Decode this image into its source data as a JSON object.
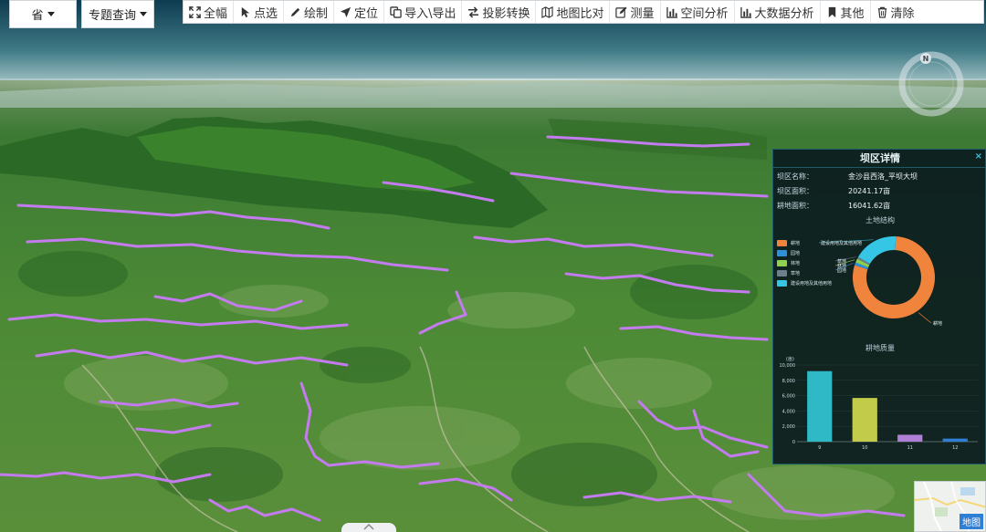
{
  "selects": {
    "province": "省",
    "topic_query": "专题查询"
  },
  "toolbar": {
    "items": [
      {
        "label": "全幅",
        "icon": "fullscreen-icon"
      },
      {
        "label": "点选",
        "icon": "pointer-icon"
      },
      {
        "label": "绘制",
        "icon": "pencil-icon"
      },
      {
        "label": "定位",
        "icon": "location-arrow-icon"
      },
      {
        "label": "导入\\导出",
        "icon": "copy-icon"
      },
      {
        "label": "投影转换",
        "icon": "exchange-icon"
      },
      {
        "label": "地图比对",
        "icon": "map-icon"
      },
      {
        "label": "测量",
        "icon": "edit-icon"
      },
      {
        "label": "空间分析",
        "icon": "bar-chart-icon"
      },
      {
        "label": "大数据分析",
        "icon": "bar-chart-icon"
      },
      {
        "label": "其他",
        "icon": "bookmark-icon"
      },
      {
        "label": "清除",
        "icon": "trash-icon"
      }
    ]
  },
  "compass": {
    "north_label": "N"
  },
  "panel": {
    "title": "坝区详情",
    "close": "×",
    "rows": [
      {
        "label": "坝区名称：",
        "value": "金沙县西洛_平坝大坝"
      },
      {
        "label": "坝区面积：",
        "value": "20241.17亩"
      },
      {
        "label": "耕地面积：",
        "value": "16041.62亩"
      }
    ],
    "land_structure_title": "土地结构",
    "land_quality_title": "耕地质量"
  },
  "chart_data": [
    {
      "type": "pie",
      "title": "土地结构",
      "donut": true,
      "legend_position": "left",
      "series": [
        {
          "name": "耕地",
          "value": 79,
          "color": "#f0843c"
        },
        {
          "name": "园地",
          "value": 1.2,
          "color": "#2f8fd8"
        },
        {
          "name": "林地",
          "value": 1.5,
          "color": "#8fd14f"
        },
        {
          "name": "草地",
          "value": 0.8,
          "color": "#6d7f8a"
        },
        {
          "name": "建设用地及其他用地",
          "value": 17.5,
          "color": "#35c6e6"
        }
      ],
      "slice_labels": [
        "耕地",
        "草地",
        "园地",
        "林地",
        "建设用地及其他用地"
      ]
    },
    {
      "type": "bar",
      "title": "耕地质量",
      "ylabel": "(亩)",
      "categories": [
        "9",
        "10",
        "11",
        "12"
      ],
      "values": [
        9200,
        5700,
        900,
        400
      ],
      "colors": [
        "#2fb8c6",
        "#c3cc4a",
        "#b07fd6",
        "#2f7fd6"
      ],
      "ylim": [
        0,
        10000
      ],
      "yticks": [
        "0",
        "2,000",
        "4,000",
        "6,000",
        "8,000",
        "10,000"
      ]
    }
  ],
  "minimap": {
    "label": "地图"
  },
  "colors": {
    "panel_bg": "#08161e",
    "accent": "#35c3e0",
    "boundary": "#c47bf0"
  }
}
